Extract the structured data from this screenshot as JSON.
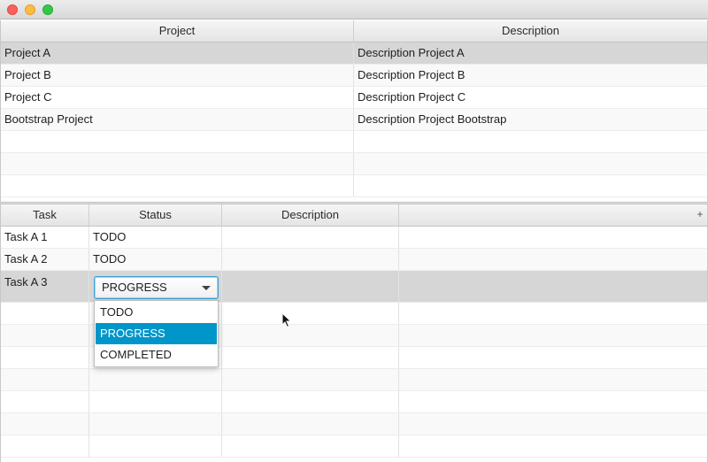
{
  "window": {
    "buttons": [
      "close",
      "minimize",
      "maximize"
    ]
  },
  "projects_table": {
    "columns": [
      "Project",
      "Description"
    ],
    "rows": [
      {
        "project": "Project A",
        "description": "Description Project A",
        "selected": true
      },
      {
        "project": "Project B",
        "description": "Description Project B"
      },
      {
        "project": "Project C",
        "description": "Description Project C"
      },
      {
        "project": "Bootstrap Project",
        "description": "Description Project Bootstrap"
      }
    ]
  },
  "tasks_table": {
    "columns": [
      "Task",
      "Status",
      "Description"
    ],
    "menu_button": "+",
    "rows": [
      {
        "task": "Task A 1",
        "status": "TODO",
        "description": ""
      },
      {
        "task": "Task A 2",
        "status": "TODO",
        "description": ""
      },
      {
        "task": "Task A 3",
        "status": "PROGRESS",
        "description": "",
        "selected": true,
        "editing": true
      }
    ]
  },
  "status_combo": {
    "value": "PROGRESS",
    "options": [
      "TODO",
      "PROGRESS",
      "COMPLETED"
    ],
    "highlighted": "PROGRESS"
  },
  "colors": {
    "selection": "#d6d6d6",
    "highlight": "#0096c9",
    "focus_border": "#3d9ed6"
  },
  "icons": {
    "combo_arrow": "chevron-down-icon",
    "cursor": "mouse-pointer-icon"
  }
}
